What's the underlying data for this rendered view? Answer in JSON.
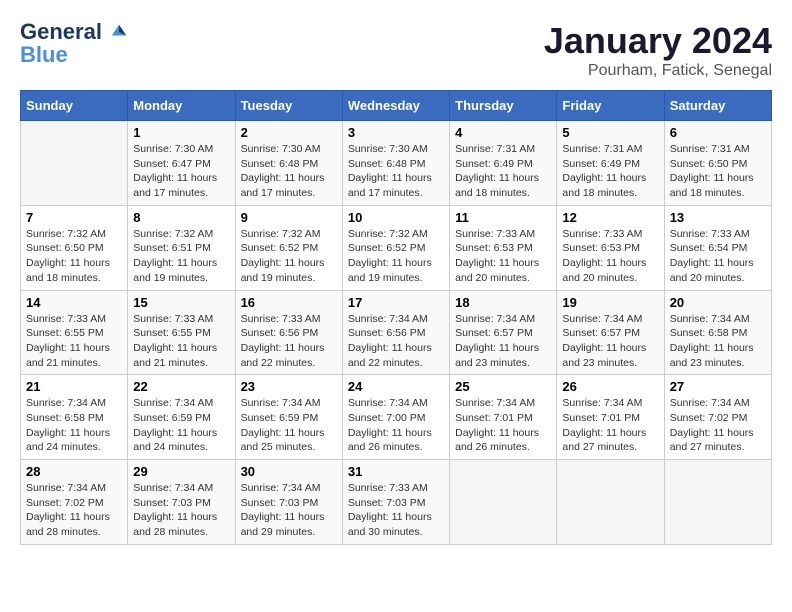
{
  "header": {
    "logo_line1": "General",
    "logo_line2": "Blue",
    "month": "January 2024",
    "location": "Pourham, Fatick, Senegal"
  },
  "weekdays": [
    "Sunday",
    "Monday",
    "Tuesday",
    "Wednesday",
    "Thursday",
    "Friday",
    "Saturday"
  ],
  "weeks": [
    [
      {
        "day": "",
        "sunrise": "",
        "sunset": "",
        "daylight": ""
      },
      {
        "day": "1",
        "sunrise": "Sunrise: 7:30 AM",
        "sunset": "Sunset: 6:47 PM",
        "daylight": "Daylight: 11 hours and 17 minutes."
      },
      {
        "day": "2",
        "sunrise": "Sunrise: 7:30 AM",
        "sunset": "Sunset: 6:48 PM",
        "daylight": "Daylight: 11 hours and 17 minutes."
      },
      {
        "day": "3",
        "sunrise": "Sunrise: 7:30 AM",
        "sunset": "Sunset: 6:48 PM",
        "daylight": "Daylight: 11 hours and 17 minutes."
      },
      {
        "day": "4",
        "sunrise": "Sunrise: 7:31 AM",
        "sunset": "Sunset: 6:49 PM",
        "daylight": "Daylight: 11 hours and 18 minutes."
      },
      {
        "day": "5",
        "sunrise": "Sunrise: 7:31 AM",
        "sunset": "Sunset: 6:49 PM",
        "daylight": "Daylight: 11 hours and 18 minutes."
      },
      {
        "day": "6",
        "sunrise": "Sunrise: 7:31 AM",
        "sunset": "Sunset: 6:50 PM",
        "daylight": "Daylight: 11 hours and 18 minutes."
      }
    ],
    [
      {
        "day": "7",
        "sunrise": "Sunrise: 7:32 AM",
        "sunset": "Sunset: 6:50 PM",
        "daylight": "Daylight: 11 hours and 18 minutes."
      },
      {
        "day": "8",
        "sunrise": "Sunrise: 7:32 AM",
        "sunset": "Sunset: 6:51 PM",
        "daylight": "Daylight: 11 hours and 19 minutes."
      },
      {
        "day": "9",
        "sunrise": "Sunrise: 7:32 AM",
        "sunset": "Sunset: 6:52 PM",
        "daylight": "Daylight: 11 hours and 19 minutes."
      },
      {
        "day": "10",
        "sunrise": "Sunrise: 7:32 AM",
        "sunset": "Sunset: 6:52 PM",
        "daylight": "Daylight: 11 hours and 19 minutes."
      },
      {
        "day": "11",
        "sunrise": "Sunrise: 7:33 AM",
        "sunset": "Sunset: 6:53 PM",
        "daylight": "Daylight: 11 hours and 20 minutes."
      },
      {
        "day": "12",
        "sunrise": "Sunrise: 7:33 AM",
        "sunset": "Sunset: 6:53 PM",
        "daylight": "Daylight: 11 hours and 20 minutes."
      },
      {
        "day": "13",
        "sunrise": "Sunrise: 7:33 AM",
        "sunset": "Sunset: 6:54 PM",
        "daylight": "Daylight: 11 hours and 20 minutes."
      }
    ],
    [
      {
        "day": "14",
        "sunrise": "Sunrise: 7:33 AM",
        "sunset": "Sunset: 6:55 PM",
        "daylight": "Daylight: 11 hours and 21 minutes."
      },
      {
        "day": "15",
        "sunrise": "Sunrise: 7:33 AM",
        "sunset": "Sunset: 6:55 PM",
        "daylight": "Daylight: 11 hours and 21 minutes."
      },
      {
        "day": "16",
        "sunrise": "Sunrise: 7:33 AM",
        "sunset": "Sunset: 6:56 PM",
        "daylight": "Daylight: 11 hours and 22 minutes."
      },
      {
        "day": "17",
        "sunrise": "Sunrise: 7:34 AM",
        "sunset": "Sunset: 6:56 PM",
        "daylight": "Daylight: 11 hours and 22 minutes."
      },
      {
        "day": "18",
        "sunrise": "Sunrise: 7:34 AM",
        "sunset": "Sunset: 6:57 PM",
        "daylight": "Daylight: 11 hours and 23 minutes."
      },
      {
        "day": "19",
        "sunrise": "Sunrise: 7:34 AM",
        "sunset": "Sunset: 6:57 PM",
        "daylight": "Daylight: 11 hours and 23 minutes."
      },
      {
        "day": "20",
        "sunrise": "Sunrise: 7:34 AM",
        "sunset": "Sunset: 6:58 PM",
        "daylight": "Daylight: 11 hours and 23 minutes."
      }
    ],
    [
      {
        "day": "21",
        "sunrise": "Sunrise: 7:34 AM",
        "sunset": "Sunset: 6:58 PM",
        "daylight": "Daylight: 11 hours and 24 minutes."
      },
      {
        "day": "22",
        "sunrise": "Sunrise: 7:34 AM",
        "sunset": "Sunset: 6:59 PM",
        "daylight": "Daylight: 11 hours and 24 minutes."
      },
      {
        "day": "23",
        "sunrise": "Sunrise: 7:34 AM",
        "sunset": "Sunset: 6:59 PM",
        "daylight": "Daylight: 11 hours and 25 minutes."
      },
      {
        "day": "24",
        "sunrise": "Sunrise: 7:34 AM",
        "sunset": "Sunset: 7:00 PM",
        "daylight": "Daylight: 11 hours and 26 minutes."
      },
      {
        "day": "25",
        "sunrise": "Sunrise: 7:34 AM",
        "sunset": "Sunset: 7:01 PM",
        "daylight": "Daylight: 11 hours and 26 minutes."
      },
      {
        "day": "26",
        "sunrise": "Sunrise: 7:34 AM",
        "sunset": "Sunset: 7:01 PM",
        "daylight": "Daylight: 11 hours and 27 minutes."
      },
      {
        "day": "27",
        "sunrise": "Sunrise: 7:34 AM",
        "sunset": "Sunset: 7:02 PM",
        "daylight": "Daylight: 11 hours and 27 minutes."
      }
    ],
    [
      {
        "day": "28",
        "sunrise": "Sunrise: 7:34 AM",
        "sunset": "Sunset: 7:02 PM",
        "daylight": "Daylight: 11 hours and 28 minutes."
      },
      {
        "day": "29",
        "sunrise": "Sunrise: 7:34 AM",
        "sunset": "Sunset: 7:03 PM",
        "daylight": "Daylight: 11 hours and 28 minutes."
      },
      {
        "day": "30",
        "sunrise": "Sunrise: 7:34 AM",
        "sunset": "Sunset: 7:03 PM",
        "daylight": "Daylight: 11 hours and 29 minutes."
      },
      {
        "day": "31",
        "sunrise": "Sunrise: 7:33 AM",
        "sunset": "Sunset: 7:03 PM",
        "daylight": "Daylight: 11 hours and 30 minutes."
      },
      {
        "day": "",
        "sunrise": "",
        "sunset": "",
        "daylight": ""
      },
      {
        "day": "",
        "sunrise": "",
        "sunset": "",
        "daylight": ""
      },
      {
        "day": "",
        "sunrise": "",
        "sunset": "",
        "daylight": ""
      }
    ]
  ]
}
